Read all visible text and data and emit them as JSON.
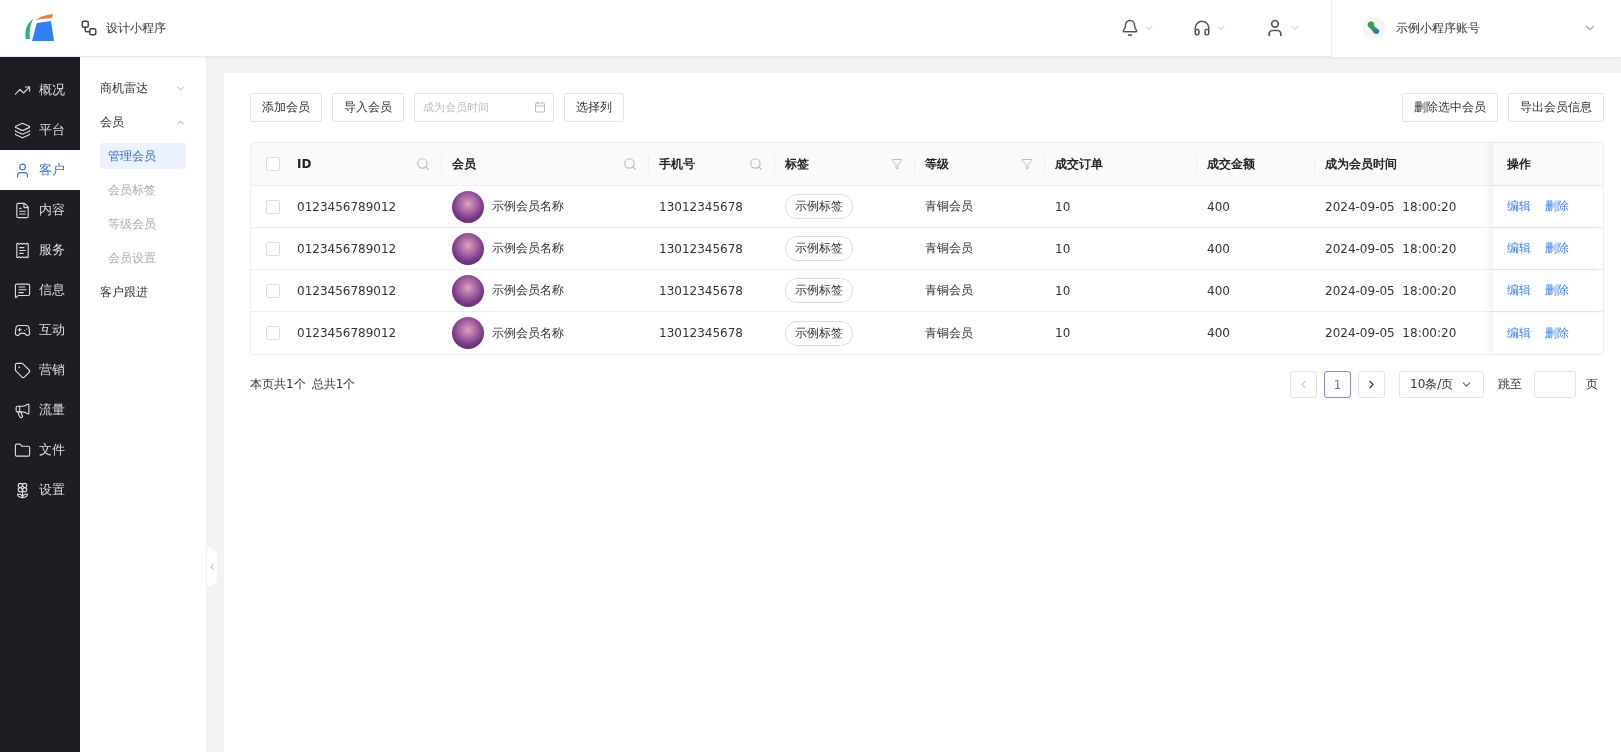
{
  "topbar": {
    "app_label": "设计小程序",
    "account": "示例小程序账号"
  },
  "nav": [
    {
      "label": "概况",
      "selected": false
    },
    {
      "label": "平台",
      "selected": false
    },
    {
      "label": "客户",
      "selected": true
    },
    {
      "label": "内容",
      "selected": false
    },
    {
      "label": "服务",
      "selected": false
    },
    {
      "label": "信息",
      "selected": false
    },
    {
      "label": "互动",
      "selected": false
    },
    {
      "label": "营销",
      "selected": false
    },
    {
      "label": "流量",
      "selected": false
    },
    {
      "label": "文件",
      "selected": false
    },
    {
      "label": "设置",
      "selected": false
    }
  ],
  "submenu": [
    {
      "label": "商机雷达",
      "kind": "group",
      "expanded": false
    },
    {
      "label": "会员",
      "kind": "group",
      "expanded": true,
      "children": [
        {
          "label": "管理会员",
          "selected": true
        },
        {
          "label": "会员标签",
          "selected": false
        },
        {
          "label": "等级会员",
          "selected": false
        },
        {
          "label": "会员设置",
          "selected": false
        }
      ]
    },
    {
      "label": "客户跟进",
      "kind": "link"
    }
  ],
  "toolbar": {
    "left_buttons": [
      "添加会员",
      "导入会员"
    ],
    "date_field": {
      "placeholder": "成为会员时间"
    },
    "column_button": "选择列",
    "right_buttons": [
      "删除选中会员",
      "导出会员信息"
    ]
  },
  "table": {
    "columns": [
      {
        "label": "ID",
        "kind": "search"
      },
      {
        "label": "会员",
        "kind": "search"
      },
      {
        "label": "手机号",
        "kind": "search"
      },
      {
        "label": "标签",
        "kind": "filter"
      },
      {
        "label": "等级",
        "kind": "filter"
      },
      {
        "label": "成交订单",
        "kind": "plain"
      },
      {
        "label": "成交金额",
        "kind": "plain"
      },
      {
        "label": "成为会员时间",
        "kind": "plain"
      },
      {
        "label": "操作",
        "kind": "fixed"
      }
    ],
    "header_checked": false,
    "rows": [
      {
        "checked": false,
        "id": "0123456789012",
        "member": "示例会员名称",
        "phone": "13012345678",
        "tag": "示例标签",
        "level": "青铜会员",
        "orders": "10",
        "amount": "400",
        "joined": "2024-09-05  18:00:20",
        "actions": [
          "编辑",
          "删除"
        ]
      },
      {
        "checked": false,
        "id": "0123456789012",
        "member": "示例会员名称",
        "phone": "13012345678",
        "tag": "示例标签",
        "level": "青铜会员",
        "orders": "10",
        "amount": "400",
        "joined": "2024-09-05  18:00:20",
        "actions": [
          "编辑",
          "删除"
        ]
      },
      {
        "checked": false,
        "id": "0123456789012",
        "member": "示例会员名称",
        "phone": "13012345678",
        "tag": "示例标签",
        "level": "青铜会员",
        "orders": "10",
        "amount": "400",
        "joined": "2024-09-05  18:00:20",
        "actions": [
          "编辑",
          "删除"
        ]
      },
      {
        "checked": false,
        "id": "0123456789012",
        "member": "示例会员名称",
        "phone": "13012345678",
        "tag": "示例标签",
        "level": "青铜会员",
        "orders": "10",
        "amount": "400",
        "joined": "2024-09-05  18:00:20",
        "actions": [
          "编辑",
          "删除"
        ]
      }
    ]
  },
  "pagination": {
    "page_count_text": "本页共1个",
    "total_text": "总共1个",
    "pages": [
      {
        "label": "1",
        "selected": true
      }
    ],
    "page_size": "10条/页",
    "jump_label": "跳至",
    "page_suffix": "页"
  }
}
